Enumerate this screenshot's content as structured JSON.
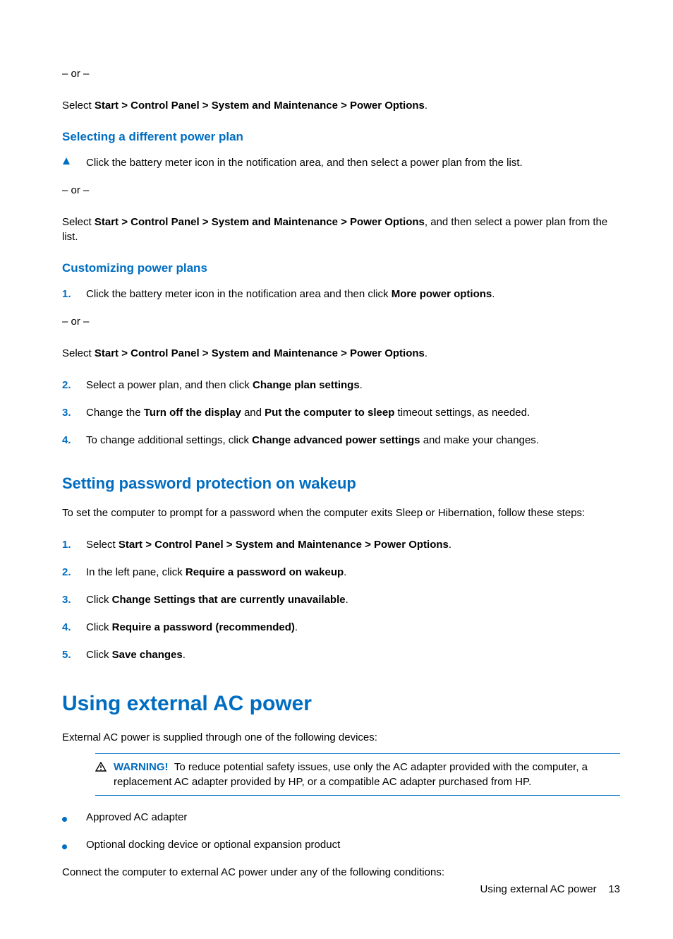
{
  "section_top": {
    "or1": "– or –",
    "select_prefix": "Select ",
    "select_bold": "Start > Control Panel > System and Maintenance > Power Options",
    "period": "."
  },
  "heading_select_plan": "Selecting a different power plan",
  "select_plan": {
    "tri_text": "Click the battery meter icon in the notification area, and then select a power plan from the list.",
    "or": "– or –",
    "select_prefix": "Select ",
    "select_bold": "Start > Control Panel > System and Maintenance > Power Options",
    "select_suffix": ", and then select a power plan from the list."
  },
  "heading_customize": "Customizing power plans",
  "customize": {
    "step1_num": "1.",
    "step1_a": "Click the battery meter icon in the notification area and then click ",
    "step1_b": "More power options",
    "step1_c": ".",
    "or": "– or –",
    "select_prefix": "Select ",
    "select_bold": "Start > Control Panel > System and Maintenance > Power Options",
    "period": ".",
    "step2_num": "2.",
    "step2_a": "Select a power plan, and then click ",
    "step2_b": "Change plan settings",
    "step2_c": ".",
    "step3_num": "3.",
    "step3_a": "Change the ",
    "step3_b": "Turn off the display",
    "step3_c": " and ",
    "step3_d": "Put the computer to sleep",
    "step3_e": " timeout settings, as needed.",
    "step4_num": "4.",
    "step4_a": "To change additional settings, click ",
    "step4_b": "Change advanced power settings",
    "step4_c": " and make your changes."
  },
  "heading_password": "Setting password protection on wakeup",
  "password": {
    "intro": "To set the computer to prompt for a password when the computer exits Sleep or Hibernation, follow these steps:",
    "step1_num": "1.",
    "step1_a": "Select ",
    "step1_b": "Start > Control Panel > System and Maintenance > Power Options",
    "step1_c": ".",
    "step2_num": "2.",
    "step2_a": "In the left pane, click ",
    "step2_b": "Require a password on wakeup",
    "step2_c": ".",
    "step3_num": "3.",
    "step3_a": "Click ",
    "step3_b": "Change Settings that are currently unavailable",
    "step3_c": ".",
    "step4_num": "4.",
    "step4_a": "Click ",
    "step4_b": "Require a password (recommended)",
    "step4_c": ".",
    "step5_num": "5.",
    "step5_a": "Click ",
    "step5_b": "Save changes",
    "step5_c": "."
  },
  "heading_ac": "Using external AC power",
  "ac": {
    "intro": "External AC power is supplied through one of the following devices:",
    "warn_label": "WARNING!",
    "warn_text": "To reduce potential safety issues, use only the AC adapter provided with the computer, a replacement AC adapter provided by HP, or a compatible AC adapter purchased from HP.",
    "bullet1": "Approved AC adapter",
    "bullet2": "Optional docking device or optional expansion product",
    "connect": "Connect the computer to external AC power under any of the following conditions:"
  },
  "footer": {
    "label": "Using external AC power",
    "page": "13"
  }
}
